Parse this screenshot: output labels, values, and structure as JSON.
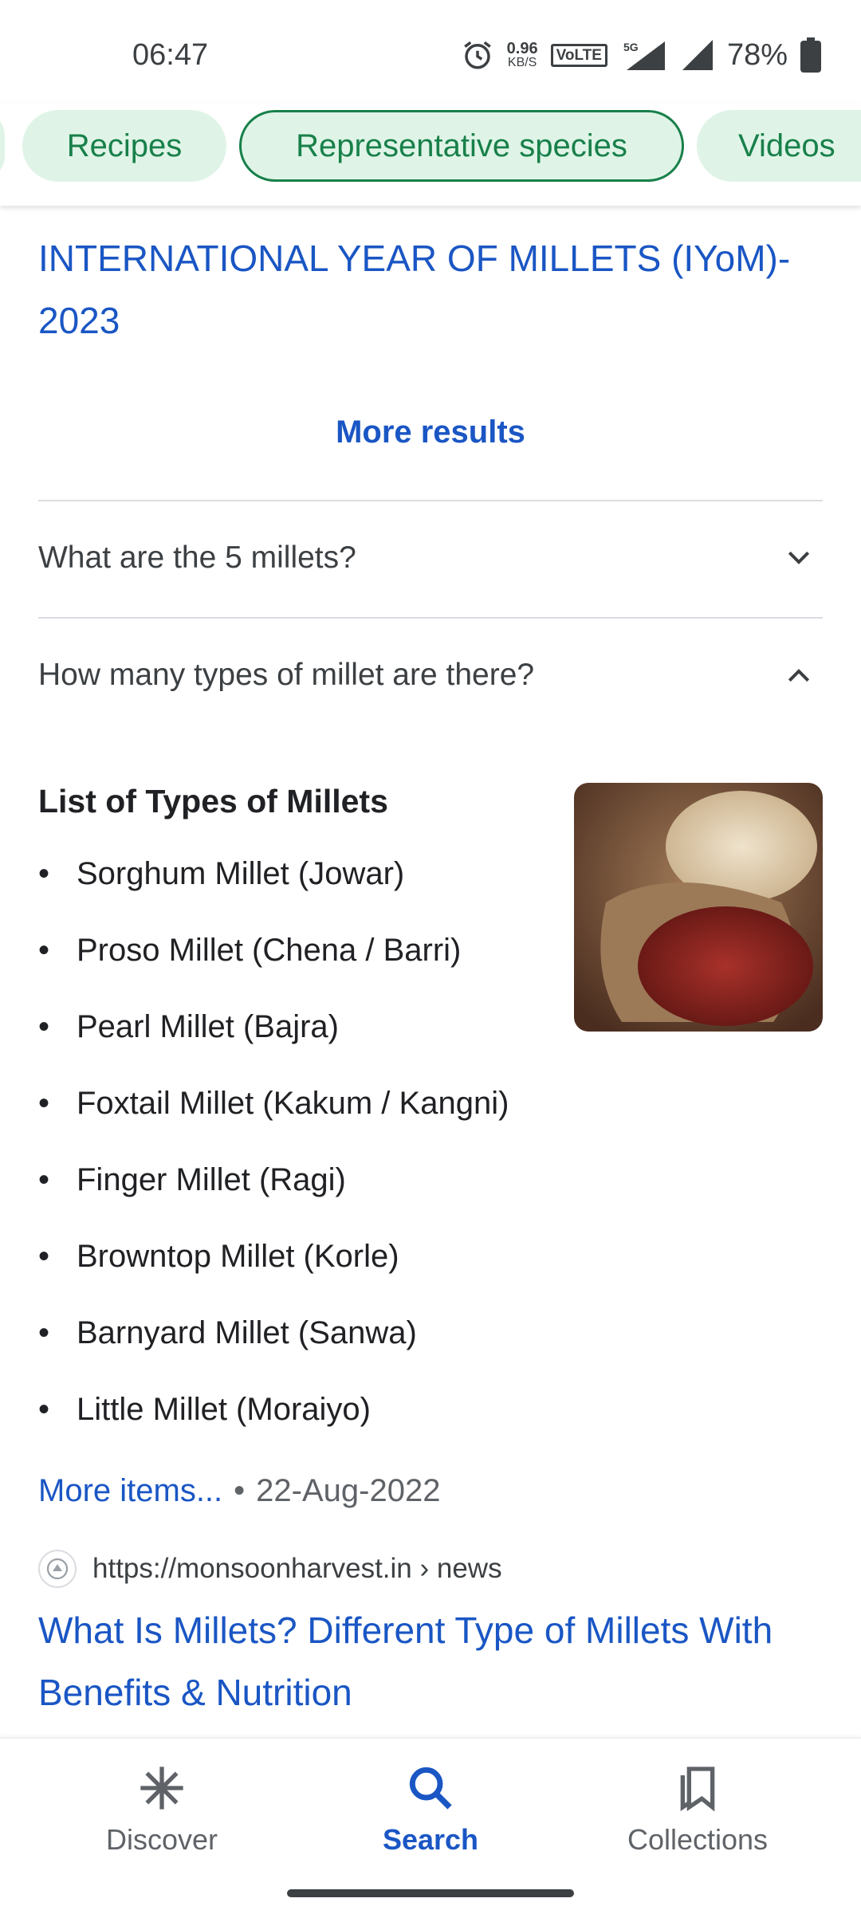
{
  "status_bar": {
    "time": "06:47",
    "net_speed_value": "0.96",
    "net_speed_unit": "KB/S",
    "volte": "VoLTE1",
    "network": "5G",
    "battery": "78%"
  },
  "chips": [
    {
      "label": "Recipes",
      "active": false
    },
    {
      "label": "Representative species",
      "active": true
    },
    {
      "label": "Videos",
      "active": false
    }
  ],
  "top_result": {
    "title_line1": "INTERNATIONAL YEAR OF MILLETS (IYoM)-",
    "title_line2": "2023"
  },
  "more_results_label": "More results",
  "faqs": [
    {
      "question": "What are the 5 millets?",
      "expanded": false
    },
    {
      "question": "How many types of millet are there?",
      "expanded": true
    }
  ],
  "answer": {
    "list_title": "List of Types of Millets",
    "items": [
      "Sorghum Millet (Jowar)",
      "Proso Millet (Chena / Barri)",
      "Pearl Millet (Bajra)",
      "Foxtail Millet (Kakum / Kangni)",
      "Finger Millet (Ragi)",
      "Browntop Millet (Korle)",
      "Barnyard Millet (Sanwa)",
      "Little Millet (Moraiyo)"
    ],
    "more_items_label": "More items...",
    "separator": "•",
    "date": "22-Aug-2022",
    "source_url": "https://monsoonharvest.in › news",
    "result_title_line1": "What Is Millets? Different Type of Millets With",
    "result_title_line2": "Benefits & Nutrition"
  },
  "bottom_nav": [
    {
      "label": "Discover",
      "icon": "asterisk-icon",
      "active": false
    },
    {
      "label": "Search",
      "icon": "search-icon",
      "active": true
    },
    {
      "label": "Collections",
      "icon": "bookmarks-icon",
      "active": false
    }
  ],
  "colors": {
    "link": "#1a56c4",
    "chip_bg": "#dff4e7",
    "chip_text": "#18804a"
  }
}
